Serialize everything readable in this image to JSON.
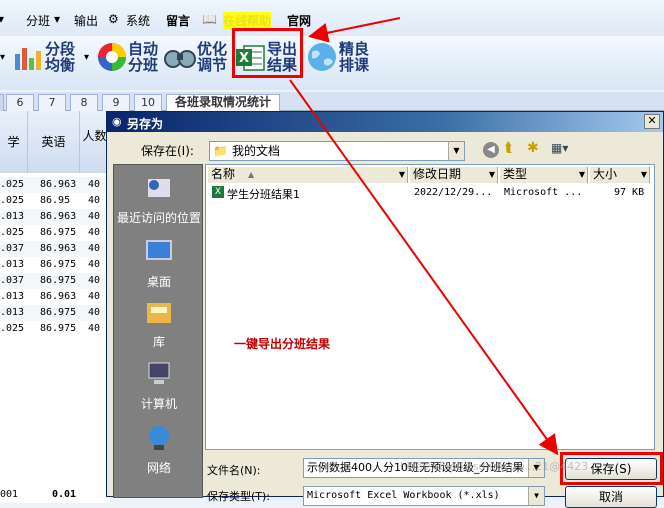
{
  "menu": {
    "items": [
      "分班",
      "输出",
      "系统",
      "留言",
      "在线帮助",
      "官网"
    ]
  },
  "toolbar": {
    "b1": [
      "分段",
      "均衡"
    ],
    "b2": [
      "自动",
      "分班"
    ],
    "b3": [
      "优化",
      "调节"
    ],
    "b4": [
      "导出",
      "结果"
    ],
    "b5": [
      "精良",
      "排课"
    ]
  },
  "tabs": [
    "6",
    "7",
    "8",
    "9",
    "10",
    "各班录取情况统计"
  ],
  "grid": {
    "h1": "学",
    "h2": "英语",
    "h3": "人数",
    "rows": [
      [
        ".025",
        "86.963",
        "40"
      ],
      [
        ".025",
        "86.95",
        "40"
      ],
      [
        ".013",
        "86.963",
        "40"
      ],
      [
        ".025",
        "86.975",
        "40"
      ],
      [
        ".037",
        "86.963",
        "40"
      ],
      [
        ".013",
        "86.975",
        "40"
      ],
      [
        ".037",
        "86.975",
        "40"
      ],
      [
        ".013",
        "86.963",
        "40"
      ],
      [
        ".013",
        "86.975",
        "40"
      ],
      [
        ".025",
        "86.975",
        "40"
      ]
    ],
    "footer": [
      "001",
      "0.01"
    ]
  },
  "dialog": {
    "title": "另存为",
    "save_in_label": "保存在(I):",
    "save_in_value": "我的文档",
    "places": [
      "最近访问的位置",
      "桌面",
      "库",
      "计算机",
      "网络"
    ],
    "columns": [
      "名称",
      "修改日期",
      "类型",
      "大小"
    ],
    "file": {
      "name": "学生分班结果1",
      "date": "2022/12/29...",
      "type": "Microsoft ...",
      "size": "97 KB"
    },
    "annotation": "一键导出分班结果",
    "filename_label": "文件名(N):",
    "filename_value": "示例数据400人分10班无预设班级_分班结果",
    "filetype_label": "保存类型(T):",
    "filetype_value": "Microsoft Excel Workbook (*.xls)",
    "save_button": "保存(S)",
    "cancel_button": "取消"
  },
  "watermark": "https://blog.csdn.net/u...21@4423"
}
